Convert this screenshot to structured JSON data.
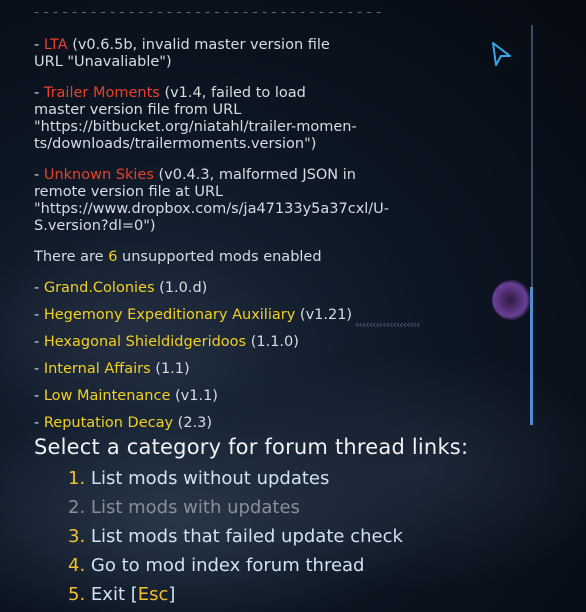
{
  "top_cut_text": "- - - - - - - - - - - - - - - - - - - - - - - - - - - - - - - - - - - - -",
  "failed_mods": [
    {
      "prefix": "- ",
      "name": "LTA",
      "lines": [
        "(v0.6.5b, invalid master version file",
        "URL \"Unavaliable\")"
      ]
    },
    {
      "prefix": "- ",
      "name": "Trailer Moments",
      "lines": [
        "(v1.4, failed to load",
        "master version file from URL",
        "\"https://bitbucket.org/niatahl/trailer-momen-",
        "ts/downloads/trailermoments.version\")"
      ]
    },
    {
      "prefix": "- ",
      "name": "Unknown Skies",
      "lines": [
        "(v0.4.3, malformed JSON in",
        "remote version file at URL",
        "\"https://www.dropbox.com/s/ja47133y5a37cxl/U-",
        "S.version?dl=0\")"
      ]
    }
  ],
  "unsupported": {
    "before": "There are ",
    "count": "6",
    "after": " unsupported mods enabled"
  },
  "unsupported_mods": [
    {
      "name": "Grand.Colonies",
      "version": "(1.0.d)"
    },
    {
      "name": "Hegemony Expeditionary Auxiliary",
      "version": "(v1.21)"
    },
    {
      "name": "Hexagonal Shieldidgeridoos",
      "version": "(1.1.0)"
    },
    {
      "name": "Internal Affairs",
      "version": "(1.1)"
    },
    {
      "name": "Low Maintenance",
      "version": "(v1.1)"
    },
    {
      "name": "Reputation Decay",
      "version": "(2.3)"
    }
  ],
  "heading": "Select a category for forum thread links:",
  "menu": [
    {
      "num": "1.",
      "label": "List mods without updates",
      "enabled": true
    },
    {
      "num": "2.",
      "label": "List mods with updates",
      "enabled": false
    },
    {
      "num": "3.",
      "label": "List mods that failed update check",
      "enabled": true
    },
    {
      "num": "4.",
      "label": "Go to mod index forum thread",
      "enabled": true
    },
    {
      "num": "5.",
      "label": "Exit [",
      "key": "Esc",
      "suffix": "]",
      "enabled": true
    }
  ],
  "trail_text": "‹‹‹‹‹‹‹‹‹‹‹‹‹‹‹‹‹‹‹",
  "colors": {
    "accent_red": "#e8402a",
    "accent_yellow": "#f2d024",
    "menu_num": "#f2c12e",
    "scroll_thumb": "#4f8fcf"
  }
}
